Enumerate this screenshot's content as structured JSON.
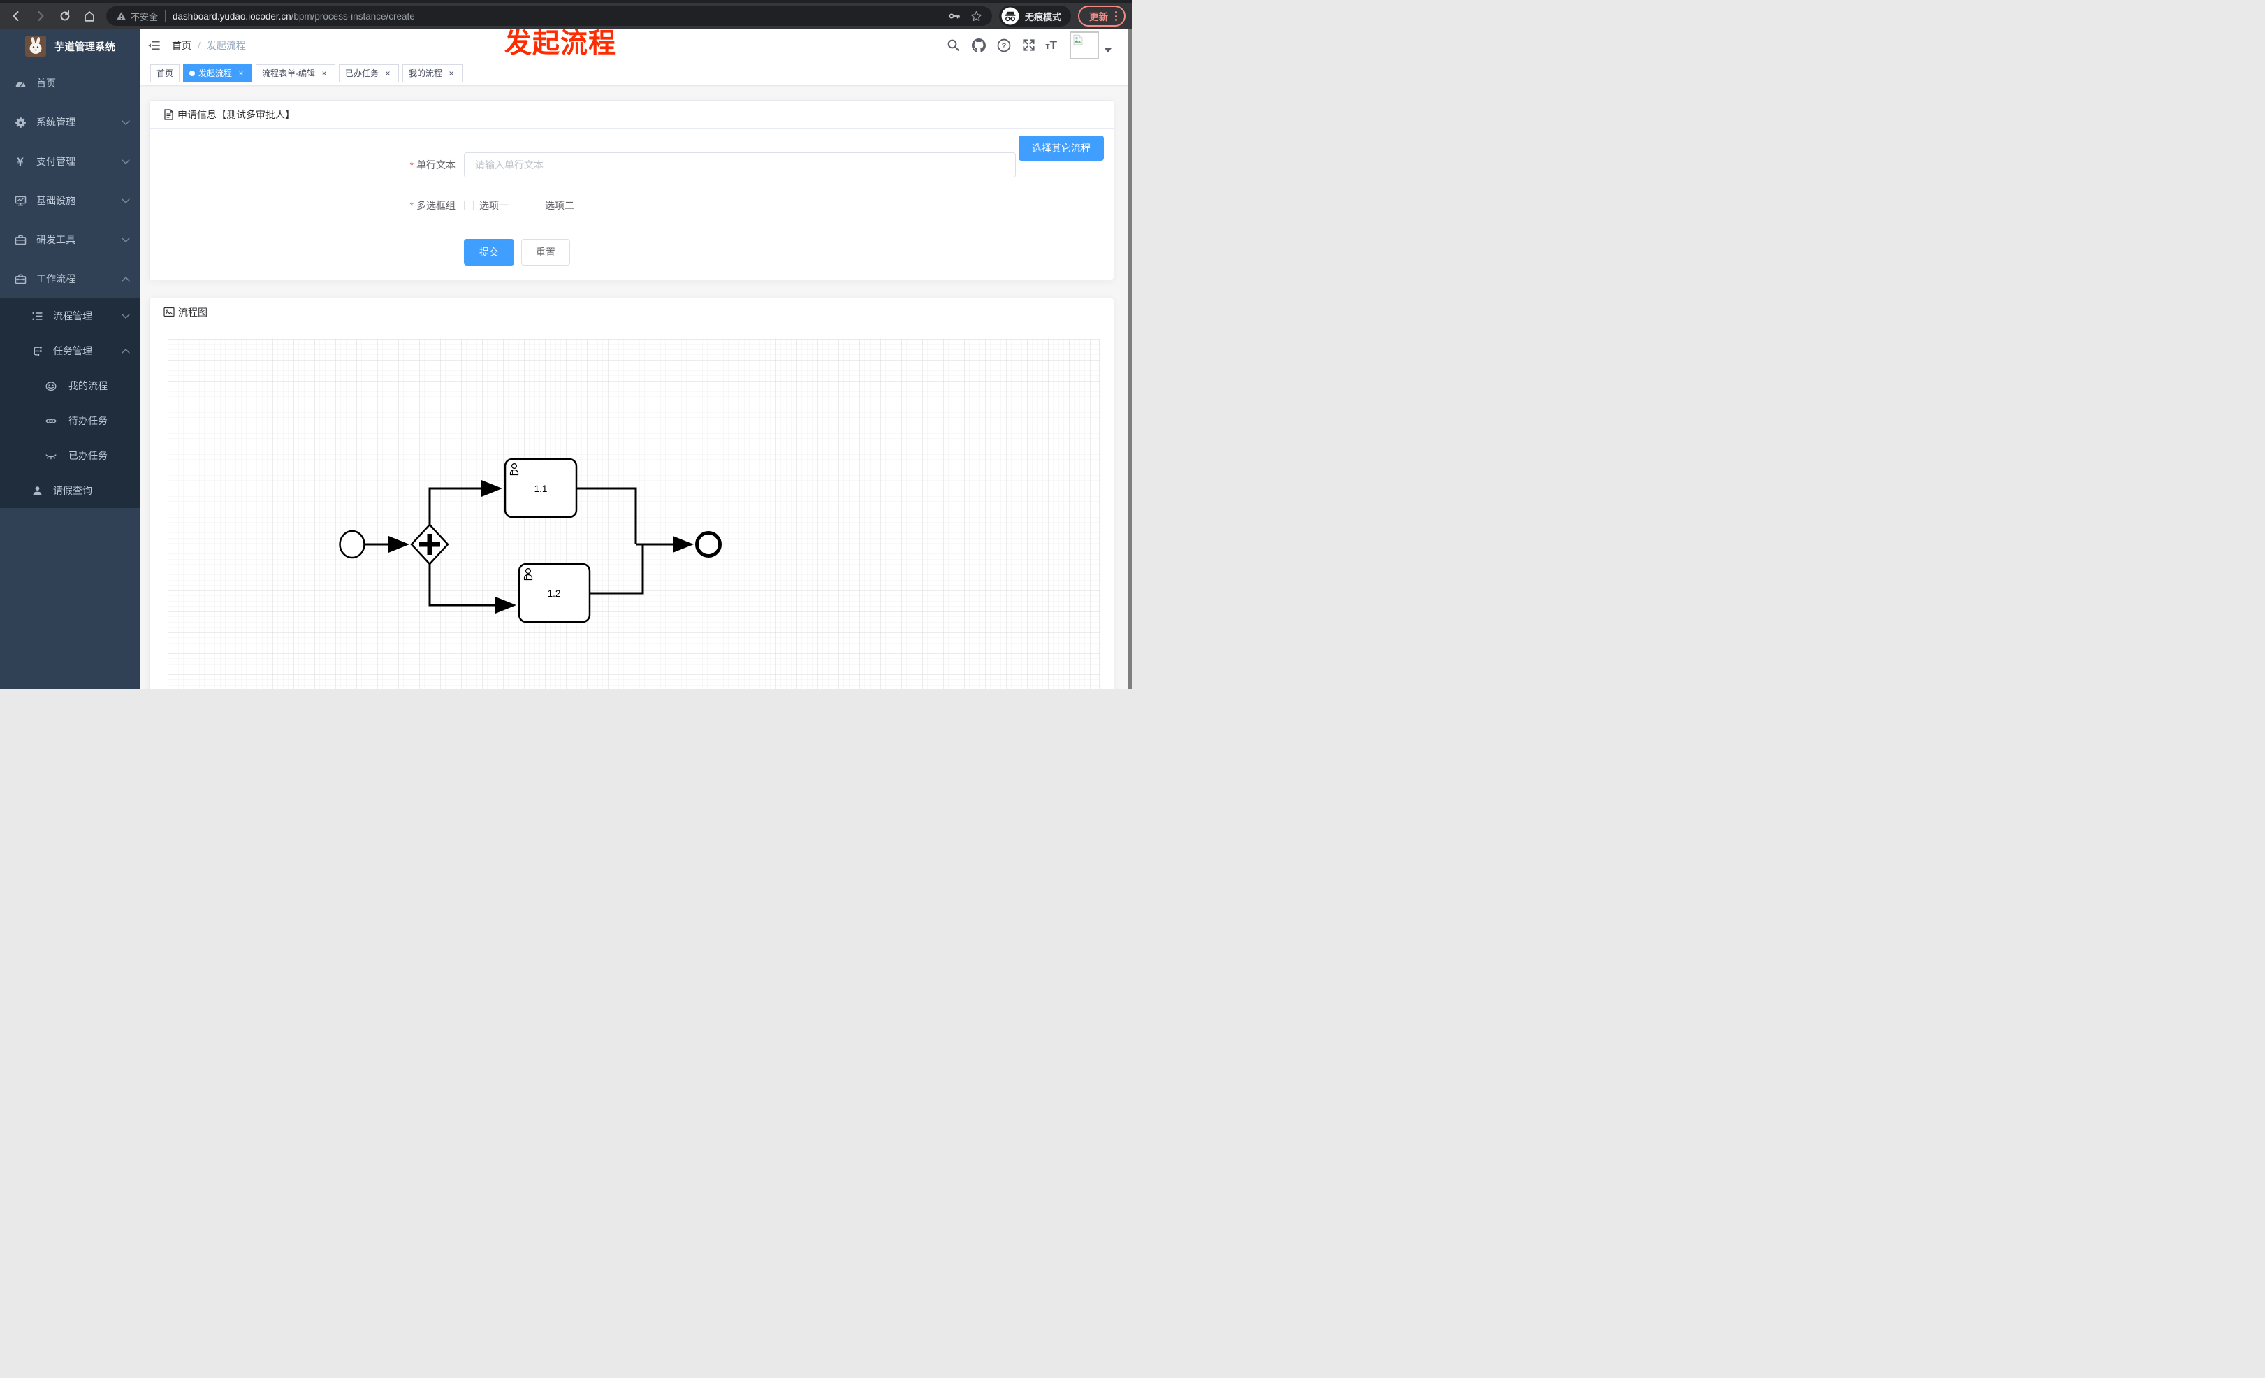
{
  "browser": {
    "security_label": "不安全",
    "url_host": "dashboard.yudao.iocoder.cn",
    "url_path": "/bpm/process-instance/create",
    "incognito_label": "无痕模式",
    "update_label": "更新"
  },
  "annotation": {
    "text": "发起流程",
    "color": "#fe2c00"
  },
  "sidebar": {
    "title": "芋道管理系统",
    "items": [
      {
        "label": "首页",
        "icon": "dashboard-icon"
      },
      {
        "label": "系统管理",
        "icon": "gear-icon",
        "chevron": "down"
      },
      {
        "label": "支付管理",
        "icon": "yen-icon",
        "chevron": "down"
      },
      {
        "label": "基础设施",
        "icon": "monitor-icon",
        "chevron": "down"
      },
      {
        "label": "研发工具",
        "icon": "briefcase-icon",
        "chevron": "down"
      },
      {
        "label": "工作流程",
        "icon": "toolbox-icon",
        "chevron": "up"
      },
      {
        "label": "流程管理",
        "icon": "tree-list-icon",
        "chevron": "down"
      },
      {
        "label": "任务管理",
        "icon": "branch-icon",
        "chevron": "up"
      },
      {
        "label": "我的流程",
        "icon": "face-icon"
      },
      {
        "label": "待办任务",
        "icon": "eye-icon"
      },
      {
        "label": "已办任务",
        "icon": "eye-closed-icon"
      },
      {
        "label": "请假查询",
        "icon": "user-icon"
      }
    ],
    "yen_glyph": "¥"
  },
  "navbar": {
    "breadcrumb": [
      "首页",
      "发起流程"
    ],
    "separator": "/",
    "help_glyph": "?",
    "font_size_glyph": "T"
  },
  "tabs": {
    "close_glyph": "×",
    "items": [
      {
        "label": "首页",
        "active": false,
        "closable": false
      },
      {
        "label": "发起流程",
        "active": true,
        "closable": true
      },
      {
        "label": "流程表单-编辑",
        "active": false,
        "closable": true
      },
      {
        "label": "已办任务",
        "active": false,
        "closable": true
      },
      {
        "label": "我的流程",
        "active": false,
        "closable": true
      }
    ]
  },
  "form_card": {
    "title": "申请信息【测试多审批人】",
    "choose_other_button": "选择其它流程",
    "text_field": {
      "label": "单行文本",
      "required": true,
      "value": "",
      "placeholder": "请输入单行文本"
    },
    "checkbox_group": {
      "label": "多选框组",
      "required": true,
      "options": [
        {
          "label": "选项一",
          "checked": false
        },
        {
          "label": "选项二",
          "checked": false
        }
      ]
    },
    "submit_label": "提交",
    "reset_label": "重置"
  },
  "diagram_card": {
    "title": "流程图",
    "diagram": {
      "nodes": [
        {
          "type": "start-event"
        },
        {
          "type": "parallel-gateway"
        },
        {
          "type": "user-task",
          "label": "1.1"
        },
        {
          "type": "user-task",
          "label": "1.2"
        },
        {
          "type": "end-event"
        }
      ],
      "flows": [
        "start → parallel-gateway",
        "parallel-gateway → task 1.1",
        "parallel-gateway → task 1.2",
        "task 1.1 → end",
        "task 1.2 → end"
      ]
    }
  },
  "colors": {
    "accent": "#409eff",
    "sidebar_bg": "#304156",
    "submenu_bg": "#1f2d3d",
    "annotation_red": "#fe2c00"
  }
}
